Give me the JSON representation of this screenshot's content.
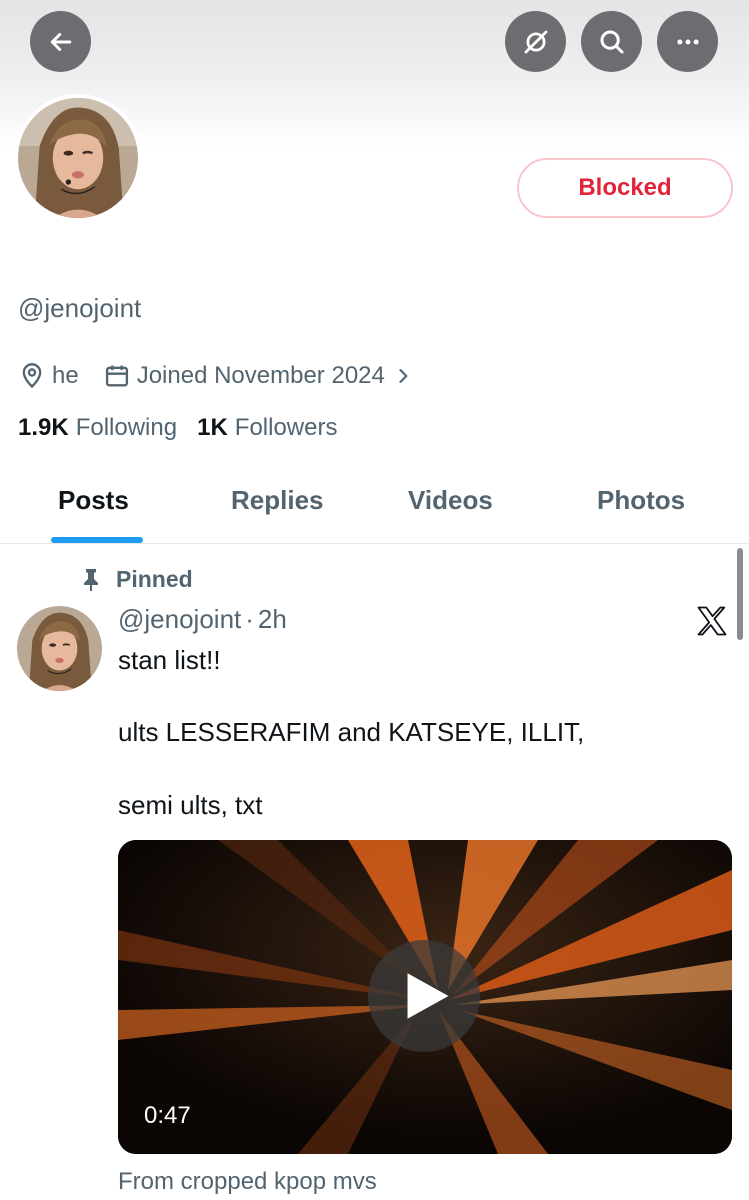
{
  "profile": {
    "blocked_label": "Blocked",
    "handle": "@jenojoint",
    "location": "he",
    "joined": "Joined November 2024",
    "following_count": "1.9K",
    "following_label": "Following",
    "followers_count": "1K",
    "followers_label": "Followers"
  },
  "tabs": [
    {
      "label": "Posts",
      "active": true
    },
    {
      "label": "Replies",
      "active": false
    },
    {
      "label": "Videos",
      "active": false
    },
    {
      "label": "Photos",
      "active": false
    }
  ],
  "post": {
    "pinned_label": "Pinned",
    "handle": "@jenojoint",
    "separator": "·",
    "time": "2h",
    "lines": [
      "stan list!!",
      "ults LESSERAFIM and KATSEYE, ILLIT,",
      "semi ults, txt"
    ],
    "video_duration": "0:47",
    "caption": "From cropped kpop mvs"
  },
  "colors": {
    "accent": "#1d9bf0",
    "blocked_red": "#e0243a",
    "secondary_text": "#536471",
    "header_button": "#6b6d70"
  },
  "icons": [
    "back-arrow-icon",
    "unlink-icon",
    "search-icon",
    "more-icon",
    "location-pin-icon",
    "calendar-icon",
    "chevron-right-icon",
    "pin-icon",
    "x-logo-icon",
    "play-icon"
  ]
}
